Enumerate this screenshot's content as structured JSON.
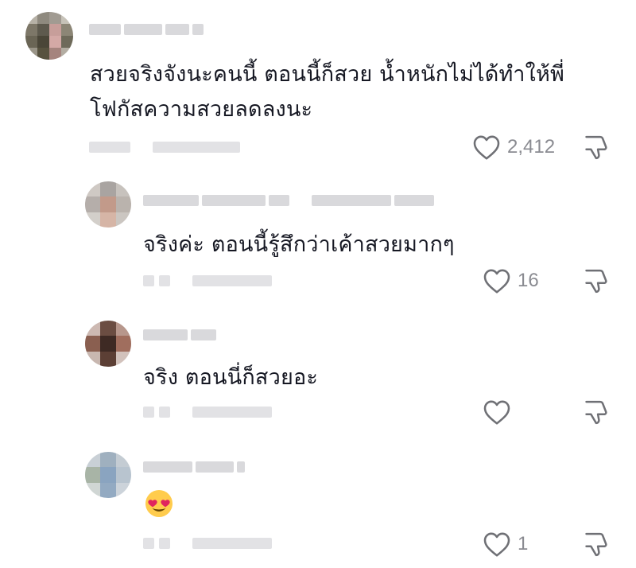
{
  "colors": {
    "text": "#161823",
    "muted": "#8a8b91",
    "icon": "#6f7075"
  },
  "comments": [
    {
      "text": "สวยจริงจังนะคนนี้ ตอนนี้ก็สวย น้ำหนักไม่ได้ทำให้พี่",
      "text_line2": "โฟกัสความสวยลดลงนะ",
      "likes": "2,412"
    },
    {
      "text": "จริงค่ะ ตอนนี้รู้สึกว่าเค้าสวยมากๆ",
      "likes": "16"
    },
    {
      "text": "จริง ตอนนี่ก็สวยอะ",
      "likes": ""
    },
    {
      "text_emoji": "heart-eyes-emoji",
      "likes": "1"
    }
  ]
}
